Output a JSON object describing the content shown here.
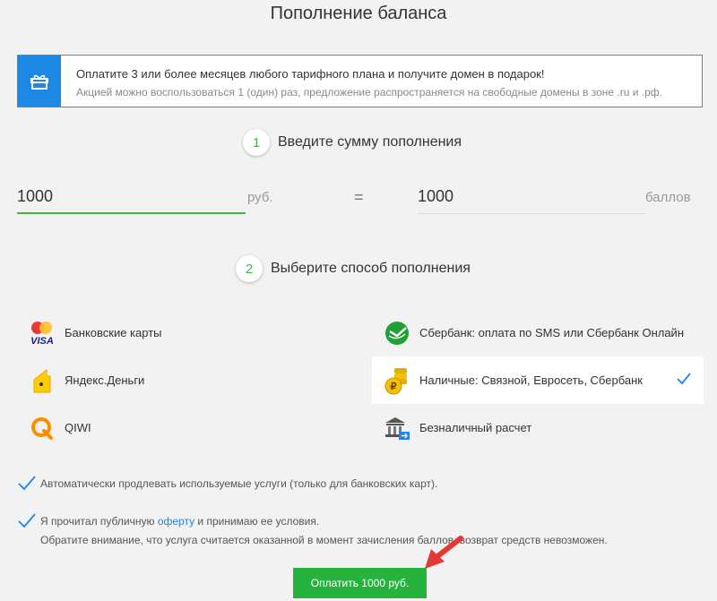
{
  "page": {
    "title": "Пополнение баланса"
  },
  "promo": {
    "icon": "gift-icon",
    "main": "Оплатите 3 или более месяцев любого тарифного плана и получите домен в подарок!",
    "sub": "Акцией можно воспользоваться 1 (один) раз, предложение распространяется на свободные домены в зоне .ru и .рф."
  },
  "step1": {
    "number": "1",
    "label": "Введите сумму пополнения"
  },
  "amount": {
    "value": "1000",
    "unit": "руб."
  },
  "equals": "=",
  "points": {
    "value": "1000",
    "unit": "баллов"
  },
  "step2": {
    "number": "2",
    "label": "Выберите способ пополнения"
  },
  "methods": [
    {
      "label": "Банковские карты",
      "icon": "mastercard-visa-icon",
      "selected": false
    },
    {
      "label": "Сбербанк: оплата по SMS или Сбербанк Онлайн",
      "icon": "sberbank-icon",
      "selected": false
    },
    {
      "label": "Яндекс.Деньги",
      "icon": "yandex-money-icon",
      "selected": false
    },
    {
      "label": "Наличные: Связной, Евросеть, Сбербанк",
      "icon": "cash-coins-icon",
      "selected": true
    },
    {
      "label": "QIWI",
      "icon": "qiwi-icon",
      "selected": false
    },
    {
      "label": "Безналичный расчет",
      "icon": "bank-transfer-icon",
      "selected": false
    }
  ],
  "options": {
    "autorenew": "Автоматически продлевать используемые услуги (только для банковских карт).",
    "offer_before": "Я прочитал публичную",
    "offer_link": "оферту",
    "offer_after": "и принимаю ее условия.",
    "notice": "Обратите внимание, что услуга считается оказанной в момент зачисления баллов, возврат средств невозможен."
  },
  "pay_button": "Оплатить 1000 руб.",
  "colors": {
    "accent_green": "#3db83f",
    "accent_blue": "#1e88e5",
    "arrow_red": "#e53935"
  }
}
